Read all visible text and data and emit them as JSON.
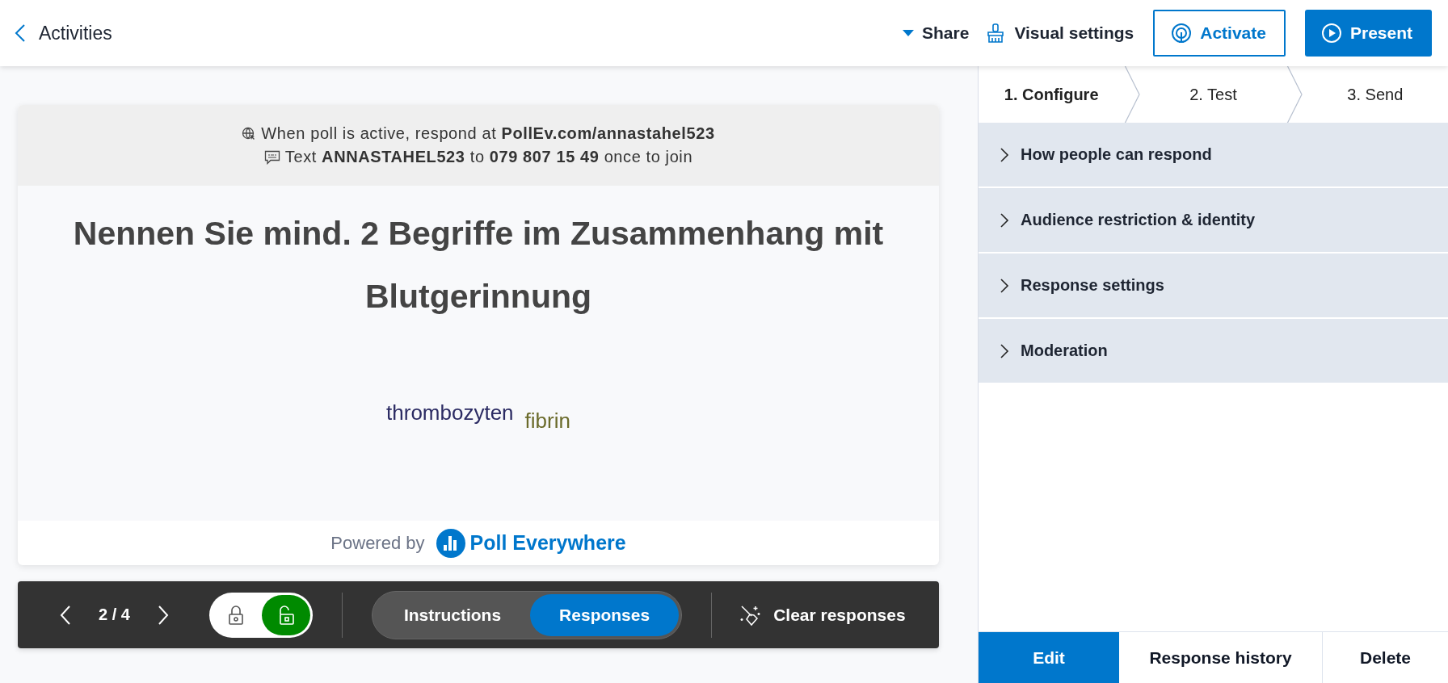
{
  "header": {
    "back": {
      "label": "Activities"
    },
    "actions": [
      {
        "kind": "share",
        "label": "Share"
      },
      {
        "kind": "visual",
        "label": "Visual settings"
      },
      {
        "kind": "activate",
        "label": "Activate"
      },
      {
        "kind": "present",
        "label": "Present"
      }
    ]
  },
  "poll": {
    "instructions": [
      {
        "kind": "web",
        "text": "When poll is active, respond at **PollEv.com/annastahel523**"
      },
      {
        "kind": "sms",
        "text": "Text **ANNASTAHEL523** to **079 807 15 49** once to join"
      }
    ],
    "title": "Nennen Sie mind. 2 Begriffe im Zusammenhang mit Blutgerinnung",
    "responses": [
      {
        "text": "thrombozyten",
        "color": "#2b2b63"
      },
      {
        "text": "fibrin",
        "color": "#6b6b2b"
      }
    ],
    "footer": {
      "prefix": "Powered by",
      "brand": "Poll Everywhere"
    }
  },
  "toolbar": {
    "counter": "2 / 4",
    "locked": false,
    "views": [
      {
        "label": "Instructions",
        "selected": false
      },
      {
        "label": "Responses",
        "selected": true
      }
    ],
    "clear": "Clear responses"
  },
  "steps": [
    {
      "label": "1. Configure",
      "selected": true
    },
    {
      "label": "2. Test",
      "selected": false
    },
    {
      "label": "3. Send",
      "selected": false
    }
  ],
  "sections": [
    {
      "label": "How people can respond",
      "expanded": false
    },
    {
      "label": "Audience restriction & identity",
      "expanded": false
    },
    {
      "label": "Response settings",
      "expanded": false
    },
    {
      "label": "Moderation",
      "expanded": false
    }
  ],
  "footer_buttons": [
    {
      "label": "Edit",
      "selected": true
    },
    {
      "label": "Response history",
      "selected": false
    },
    {
      "label": "Delete",
      "selected": false
    }
  ]
}
